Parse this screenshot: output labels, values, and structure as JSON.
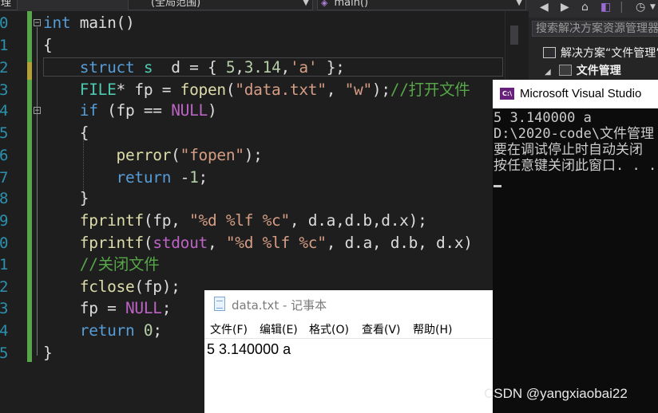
{
  "editor": {
    "file_dropdown": "理",
    "scope_dropdown": "(全局范围)",
    "function_dropdown": "main()",
    "line_numbers": [
      "0",
      "1",
      "2",
      "3",
      "4",
      "5",
      "6",
      "7",
      "8",
      "9",
      "0",
      "1",
      "2",
      "3",
      "4",
      "5"
    ],
    "code": {
      "l0_kw": "int",
      "l0_rest": " main()",
      "l1": "{",
      "l2_kw": "struct",
      "l2_ty": "s",
      "l2_a": "  d = { ",
      "l2_n1": "5",
      "l2_b": ",",
      "l2_n2": "3.14",
      "l2_c": ",",
      "l2_s": "'a'",
      "l2_d": " };",
      "l3_ty": "FILE",
      "l3_a": "* fp = ",
      "l3_fn": "fopen",
      "l3_b": "(",
      "l3_s1": "\"data.txt\"",
      "l3_c": ", ",
      "l3_s2": "\"w\"",
      "l3_d": ");",
      "l3_cm": "//打开文件",
      "l4_kw": "if",
      "l4_a": " (fp == ",
      "l4_ma": "NULL",
      "l4_b": ")",
      "l5": "{",
      "l6_fn": "perror",
      "l6_a": "(",
      "l6_s": "\"fopen\"",
      "l6_b": ");",
      "l7_kw": "return",
      "l7_a": " -",
      "l7_n": "1",
      "l7_b": ";",
      "l8": "}",
      "l9_fn": "fprintf",
      "l9_a": "(fp, ",
      "l9_s": "\"%d %lf %c\"",
      "l9_b": ", d.a,d.b,d.x);",
      "l10_fn": "fprintf",
      "l10_a": "(",
      "l10_ma": "stdout",
      "l10_b": ", ",
      "l10_s": "\"%d %lf %c\"",
      "l10_c": ", d.a, d.b, d.x)",
      "l11_cm": "//关闭文件",
      "l12_fn": "fclose",
      "l12_a": "(fp);",
      "l13_a": "fp = ",
      "l13_ma": "NULL",
      "l13_b": ";",
      "l14_kw": "return",
      "l14_a": " ",
      "l14_n": "0",
      "l14_b": ";",
      "l15": "}"
    }
  },
  "solution_explorer": {
    "search_placeholder": "搜索解决方案资源管理器",
    "solution_label": "解决方案“文件管理”",
    "project_label": "文件管理",
    "expand_glyph": "◢"
  },
  "console": {
    "title": "Microsoft Visual Studio",
    "lines": [
      "5 3.140000 a",
      "D:\\2020-code\\文件管理",
      "要在调试停止时自动关闭",
      "按任意键关闭此窗口. . ."
    ]
  },
  "notepad": {
    "title": "data.txt - 记事本",
    "menu": [
      "文件(F)",
      "编辑(E)",
      "格式(O)",
      "查看(V)",
      "帮助(H)"
    ],
    "content": "5 3.140000 a"
  },
  "watermark": "CSDN @yangxiaobai22",
  "colors": {
    "editor_bg": "#1e1e1e",
    "keyword": "#569cd6",
    "type": "#4ec9b0",
    "string": "#d69d85",
    "comment": "#57a64a",
    "macro": "#bd63c5",
    "console_bg": "#0c0c0c"
  }
}
